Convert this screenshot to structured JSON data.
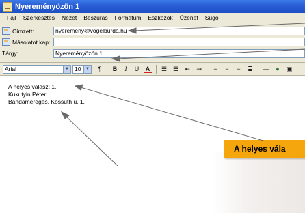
{
  "window": {
    "title": "Nyereményözön 1"
  },
  "menu": [
    "Fájl",
    "Szerkesztés",
    "Nézet",
    "Beszúrás",
    "Formátum",
    "Eszközök",
    "Üzenet",
    "Súgó"
  ],
  "fields": {
    "to_label": "Címzett:",
    "to_value": "nyeremeny@vogelburda.hu",
    "cc_label": "Másolatot kap:",
    "cc_value": "",
    "subject_label": "Tárgy:",
    "subject_value": "Nyereményözön 1"
  },
  "format_toolbar": {
    "font": "Arial",
    "size": "10",
    "buttons": [
      "B",
      "I",
      "U",
      "A"
    ]
  },
  "body_lines": [
    "A helyes válasz: 1.",
    "Kukutyin Péter",
    "Bandaméreges, Kossuth u. 1."
  ],
  "annotation": {
    "callout_text": "A helyes vála",
    "color": "#f4a60c"
  }
}
